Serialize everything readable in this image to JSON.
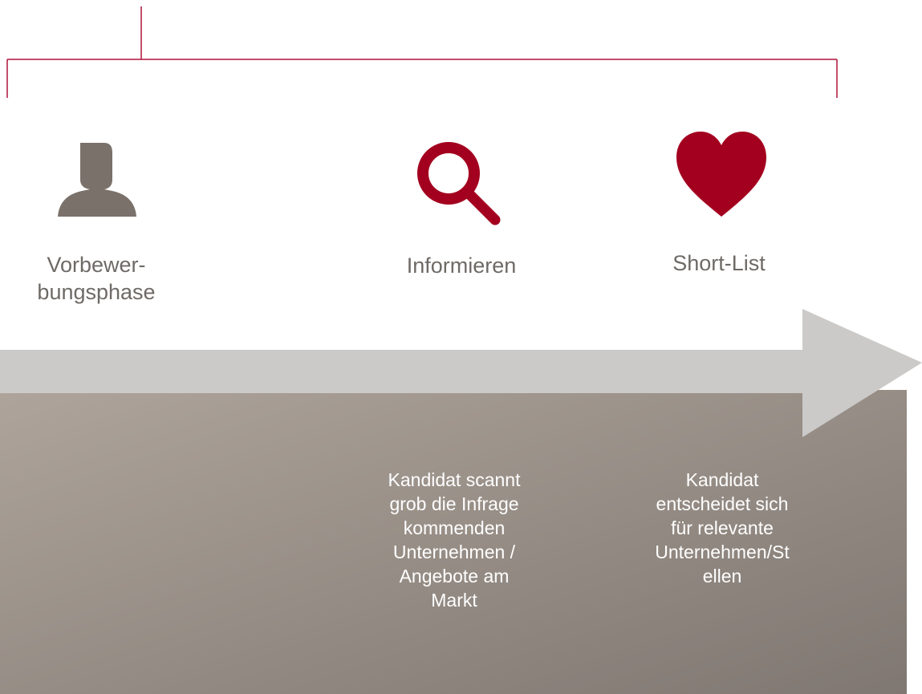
{
  "title": "",
  "colors": {
    "accent": "#a3001f",
    "bracket": "#b0133b",
    "person_icon": "#7a716a",
    "arrow": "#cbcac9",
    "panel_top": "#aea49b",
    "panel_bottom": "#7f7771",
    "label_text": "#6e6a66",
    "desc_text": "#ffffff"
  },
  "phases": [
    {
      "icon": "person-icon",
      "label": "Vorbewer-\nbungsphase",
      "description": ""
    },
    {
      "icon": "search-icon",
      "label": "Informieren",
      "description": "Kandidat scannt\ngrob die Infrage\nkommenden\nUnternehmen /\nAngebote am\nMarkt"
    },
    {
      "icon": "heart-icon",
      "label": "Short-List",
      "description": "Kandidat\nentscheidet sich\nfür relevante\nUnternehmen/St\nellen"
    }
  ]
}
